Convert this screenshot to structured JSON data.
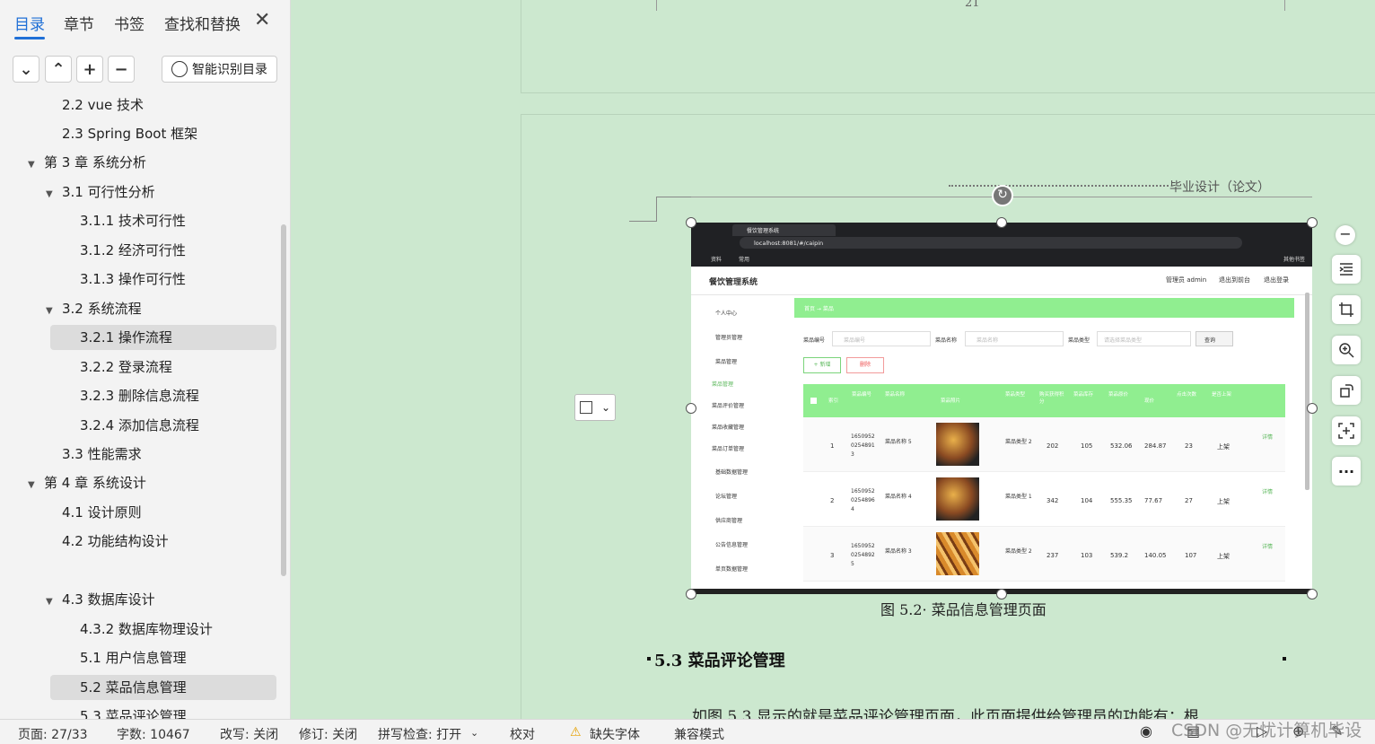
{
  "nav": {
    "tabs": [
      "目录",
      "章节",
      "书签",
      "查找和替换"
    ],
    "smart_label": "智能识别目录",
    "toc": [
      "2.2 vue 技术",
      "2.3 Spring Boot 框架",
      "第 3 章  系统分析",
      "3.1  可行性分析",
      "3.1.1  技术可行性",
      "3.1.2  经济可行性",
      "3.1.3  操作可行性",
      "3.2  系统流程",
      "3.2.1  操作流程",
      "3.2.2  登录流程",
      "3.2.3  删除信息流程",
      "3.2.4  添加信息流程",
      "3.3  性能需求",
      "第 4 章  系统设计",
      "4.1  设计原则",
      "4.2  功能结构设计",
      "4.3  数据库设计",
      "4.3.2  数据库物理设计",
      "5.1 用户信息管理",
      "5.2  菜品信息管理",
      "5.3 菜品评论管理"
    ]
  },
  "doc": {
    "page_no": "21",
    "header": "毕业设计（论文）",
    "caption": "图 5.2· 菜品信息管理页面",
    "heading": "5.3 菜品评论管理",
    "body": "如图 5.3 显示的就是菜品评论管理页面，此页面提供给管理员的功能有：根"
  },
  "shot": {
    "tab_title": "餐饮管理系统",
    "url": "localhost:8081/#/caipin",
    "bm1": "资料",
    "bm2": "常用",
    "bm3": "其他书签",
    "app_title": "餐饮管理系统",
    "user": "管理员 admin",
    "nav_r1": "退出到前台",
    "nav_r2": "退出登录",
    "menu": [
      "个人中心",
      "管理员管理",
      "菜品管理",
      "菜品管理",
      "菜品评价管理",
      "菜品收藏管理",
      "菜品订单管理",
      "基础数据管理",
      "论坛管理",
      "供应商管理",
      "公告信息管理",
      "单页数据管理"
    ],
    "breadcrumb": "首页 → 菜品",
    "f1": "菜品编号",
    "f1p": "菜品编号",
    "f2": "菜品名称",
    "f2p": "菜品名称",
    "f3": "菜品类型",
    "f3p": "请选择菜品类型",
    "search": "查询",
    "add": "+ 新增",
    "del": "删除",
    "cols": [
      "索引",
      "菜品编号",
      "菜品名称",
      "菜品照片",
      "菜品类型",
      "购买获得积分",
      "菜品库存",
      "菜品原价",
      "现价",
      "点击次数",
      "是否上架"
    ],
    "rows": [
      {
        "i": "1",
        "code": "1650952 0254891 3",
        "name": "菜品名称 5",
        "type": "菜品类型 2",
        "pts": "202",
        "stock": "105",
        "orig": "532.06",
        "now": "284.87",
        "clicks": "23",
        "up": "上架"
      },
      {
        "i": "2",
        "code": "1650952 0254896 4",
        "name": "菜品名称 4",
        "type": "菜品类型 1",
        "pts": "342",
        "stock": "104",
        "orig": "555.35",
        "now": "77.67",
        "clicks": "27",
        "up": "上架"
      },
      {
        "i": "3",
        "code": "1650952 0254892 5",
        "name": "菜品名称 3",
        "type": "菜品类型 2",
        "pts": "237",
        "stock": "103",
        "orig": "539.2",
        "now": "140.05",
        "clicks": "107",
        "up": "上架"
      }
    ],
    "detail": "详情"
  },
  "status": {
    "page": "页面: 27/33",
    "words": "字数: 10467",
    "rewrite": "改写: 关闭",
    "track": "修订: 关闭",
    "spell": "拼写检查: 打开",
    "proof": "校对",
    "font": "缺失字体",
    "compat": "兼容模式",
    "watermark": "CSDN @无忧计算机毕设"
  },
  "colors": {
    "accent": "#1f6fd6",
    "page_bg": "#cce8cf",
    "app_green": "#90ee90"
  }
}
